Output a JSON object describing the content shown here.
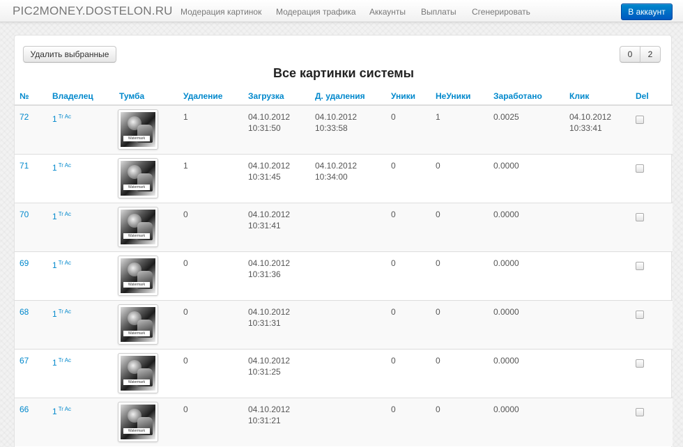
{
  "nav": {
    "brand": "PIC2MONEY.DOSTELON.RU",
    "links": [
      "Модерация картинок",
      "Модерация трафика",
      "Аккаунты",
      "Выплаты",
      "Сгенерировать"
    ],
    "account_button": "В аккаунт"
  },
  "toolbar": {
    "delete_selected": "Удалить выбранные",
    "pages": [
      "0",
      "2"
    ]
  },
  "page_title": "Все картинки системы",
  "table": {
    "headers": [
      "№",
      "Владелец",
      "Тумба",
      "Удаление",
      "Загрузка",
      "Д. удаления",
      "Уники",
      "НеУники",
      "Заработано",
      "Клик",
      "Del"
    ],
    "watermark_text": "Watermark",
    "rows": [
      {
        "id": "72",
        "owner": "1",
        "owner_tags": "Tr Ac",
        "deletion": "1",
        "upload_date": "04.10.2012",
        "upload_time": "10:31:50",
        "del_date": "04.10.2012",
        "del_time": "10:33:58",
        "uniques": "0",
        "non_uniques": "1",
        "earned": "0.0025",
        "click_date": "04.10.2012",
        "click_time": "10:33:41"
      },
      {
        "id": "71",
        "owner": "1",
        "owner_tags": "Tr Ac",
        "deletion": "1",
        "upload_date": "04.10.2012",
        "upload_time": "10:31:45",
        "del_date": "04.10.2012",
        "del_time": "10:34:00",
        "uniques": "0",
        "non_uniques": "0",
        "earned": "0.0000",
        "click_date": "",
        "click_time": ""
      },
      {
        "id": "70",
        "owner": "1",
        "owner_tags": "Tr Ac",
        "deletion": "0",
        "upload_date": "04.10.2012",
        "upload_time": "10:31:41",
        "del_date": "",
        "del_time": "",
        "uniques": "0",
        "non_uniques": "0",
        "earned": "0.0000",
        "click_date": "",
        "click_time": ""
      },
      {
        "id": "69",
        "owner": "1",
        "owner_tags": "Tr Ac",
        "deletion": "0",
        "upload_date": "04.10.2012",
        "upload_time": "10:31:36",
        "del_date": "",
        "del_time": "",
        "uniques": "0",
        "non_uniques": "0",
        "earned": "0.0000",
        "click_date": "",
        "click_time": ""
      },
      {
        "id": "68",
        "owner": "1",
        "owner_tags": "Tr Ac",
        "deletion": "0",
        "upload_date": "04.10.2012",
        "upload_time": "10:31:31",
        "del_date": "",
        "del_time": "",
        "uniques": "0",
        "non_uniques": "0",
        "earned": "0.0000",
        "click_date": "",
        "click_time": ""
      },
      {
        "id": "67",
        "owner": "1",
        "owner_tags": "Tr Ac",
        "deletion": "0",
        "upload_date": "04.10.2012",
        "upload_time": "10:31:25",
        "del_date": "",
        "del_time": "",
        "uniques": "0",
        "non_uniques": "0",
        "earned": "0.0000",
        "click_date": "",
        "click_time": ""
      },
      {
        "id": "66",
        "owner": "1",
        "owner_tags": "Tr Ac",
        "deletion": "0",
        "upload_date": "04.10.2012",
        "upload_time": "10:31:21",
        "del_date": "",
        "del_time": "",
        "uniques": "0",
        "non_uniques": "0",
        "earned": "0.0000",
        "click_date": "",
        "click_time": ""
      }
    ]
  }
}
